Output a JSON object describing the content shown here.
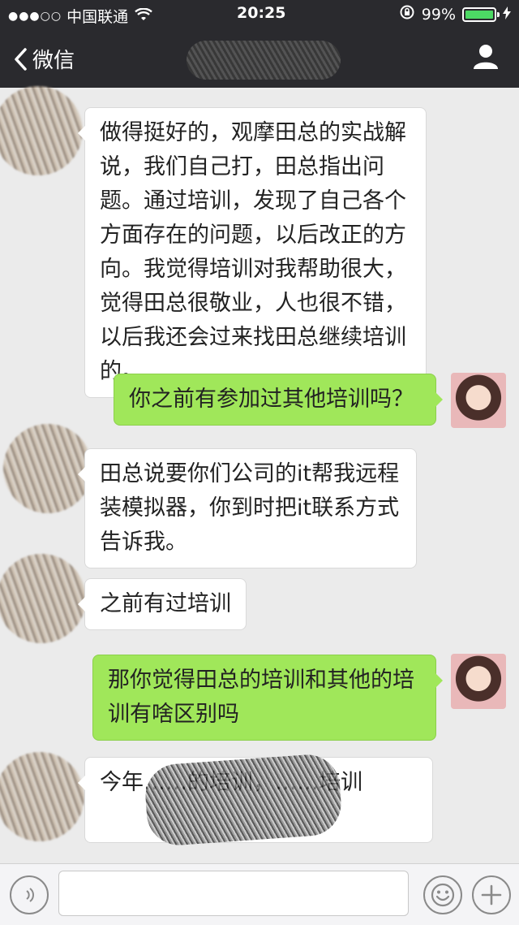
{
  "status_bar": {
    "signal": "●●●○○",
    "carrier": "中国联通",
    "time": "20:25",
    "battery_text": "99%",
    "battery_level": 0.99
  },
  "nav": {
    "back_label": "微信"
  },
  "messages": [
    {
      "side": "in",
      "text": "做得挺好的，观摩田总的实战解说，我们自己打，田总指出问题。通过培训，发现了自己各个方面存在的问题，以后改正的方向。我觉得培训对我帮助很大，觉得田总很敬业，人也很不错，以后我还会过来找田总继续培训的。"
    },
    {
      "side": "out",
      "text": "你之前有参加过其他培训吗？"
    },
    {
      "side": "in",
      "text": "田总说要你们公司的it帮我远程装模拟器，你到时把it联系方式告诉我。"
    },
    {
      "side": "in",
      "text": "之前有过培训"
    },
    {
      "side": "out",
      "text": "那你觉得田总的培训和其他的培训有啥区别吗"
    },
    {
      "side": "in",
      "text": "今年……的培训，……培训"
    }
  ],
  "colors": {
    "header_bg": "#2a2a2e",
    "chat_bg": "#ebebeb",
    "bubble_out": "#a0e75a",
    "bubble_in": "#ffffff"
  }
}
